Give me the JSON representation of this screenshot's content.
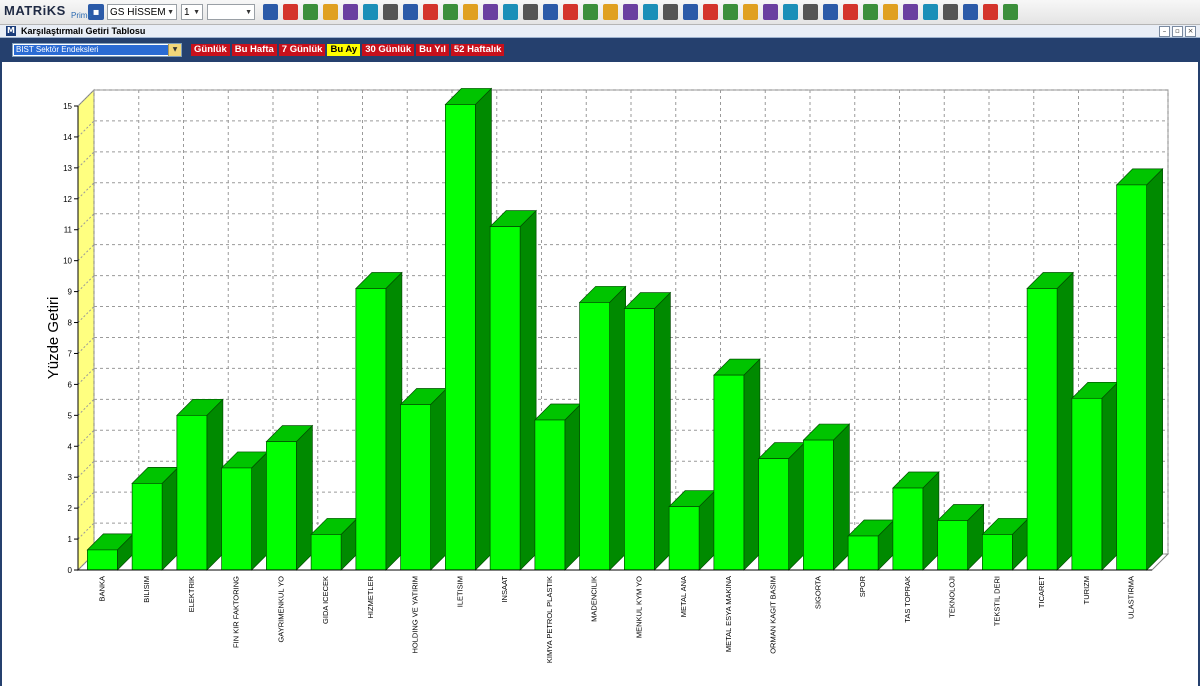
{
  "toolbar": {
    "brand": "MATRiKS",
    "brand_sub": "Prime",
    "portfolio_select": "GS HİSSEM",
    "number_select": "1",
    "empty_select": "",
    "icons": [
      "save-icon",
      "zoom-icon",
      "pointer-icon",
      "chart-icon",
      "globe-icon",
      "monitor-icon",
      "clock-icon",
      "eye-icon",
      "news-icon",
      "grid-icon",
      "bold-icon",
      "font-color-icon",
      "underline-icon",
      "help-icon",
      "refresh-icon",
      "email-icon",
      "gmail-icon",
      "line-chart-icon",
      "formula-icon",
      "user-icon",
      "users-icon",
      "phone-icon",
      "calendar-icon",
      "copy-icon",
      "notes-icon",
      "search-icon",
      "twitter-icon",
      "book-icon",
      "v-icon",
      "image-icon",
      "window-icon",
      "window2-icon",
      "arrow-icon",
      "bell-icon",
      "mail-icon",
      "calculator-icon",
      "chat-icon",
      "settings-icon"
    ]
  },
  "window": {
    "title": "Karşılaştırmalı Getiri Tablosu",
    "icon_letter": "M"
  },
  "filter": {
    "index_select": "BIST Sektör Endeksleri",
    "periods": [
      {
        "label": "Günlük",
        "active": false
      },
      {
        "label": "Bu Hafta",
        "active": false
      },
      {
        "label": "7 Günlük",
        "active": false
      },
      {
        "label": "Bu Ay",
        "active": true
      },
      {
        "label": "30 Günlük",
        "active": false
      },
      {
        "label": "Bu Yıl",
        "active": false
      },
      {
        "label": "52 Haftalık",
        "active": false
      }
    ]
  },
  "colors": {
    "bar_front": "#00ff00",
    "bar_side": "#008a00",
    "bar_top": "#00c400",
    "left_wall": "#ffff80",
    "active_period": "#ffff00",
    "period": "#c8101b",
    "header_bg": "#25406e"
  },
  "chart_data": {
    "type": "bar",
    "ylabel": "Yüzde Getiri",
    "xlabel": "",
    "ylim": [
      0,
      15
    ],
    "grid": true,
    "yticks": [
      0,
      1,
      2,
      3,
      4,
      5,
      6,
      7,
      8,
      9,
      10,
      11,
      12,
      13,
      14,
      15
    ],
    "categories": [
      "BANKA",
      "BILISIM",
      "ELEKTRIK",
      "FIN KIR FAKTORING",
      "GAYRIMENKUL YO",
      "GIDA ICECEK",
      "HIZMETLER",
      "HOLDING VE YATIRIM",
      "ILETISIM",
      "INSAAT",
      "KIMYA PETROL PLASTIK",
      "MADENCILIK",
      "MENKUL KYM YO",
      "METAL ANA",
      "METAL ESYA MAKINA",
      "ORMAN KAGIT BASIM",
      "SIGORTA",
      "SPOR",
      "TAS TOPRAK",
      "TEKNOLOJI",
      "TEKSTIL DERI",
      "TICARET",
      "TURIZM",
      "ULASTIRMA"
    ],
    "values": [
      0.65,
      2.8,
      5.0,
      3.3,
      4.15,
      1.15,
      9.1,
      5.35,
      15.05,
      11.1,
      4.85,
      8.65,
      8.45,
      2.05,
      6.3,
      3.6,
      4.2,
      1.1,
      2.65,
      1.6,
      1.15,
      9.1,
      5.55,
      12.45
    ]
  }
}
